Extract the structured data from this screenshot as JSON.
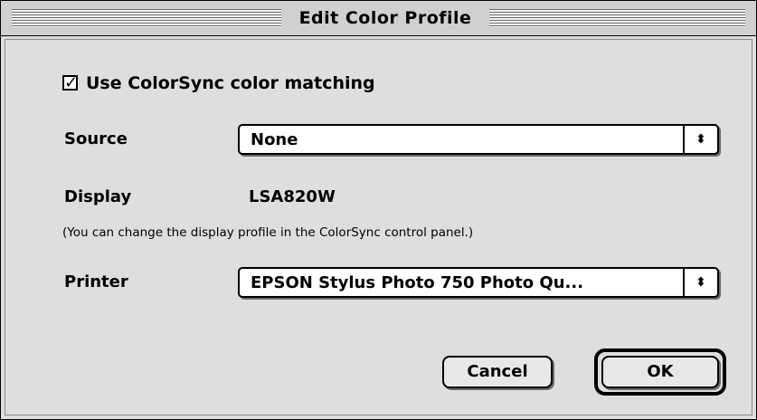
{
  "window": {
    "title": "Edit Color Profile"
  },
  "colorsync": {
    "checked": true,
    "check_glyph": "✓",
    "label": "Use ColorSync color matching"
  },
  "source": {
    "label": "Source",
    "selected": "None",
    "arrow_glyph": "⬍"
  },
  "display": {
    "label": "Display",
    "value": "LSA820W",
    "note": "(You can change the display profile in the ColorSync control panel.)"
  },
  "printer": {
    "label": "Printer",
    "selected": "EPSON Stylus Photo 750 Photo Qu...",
    "arrow_glyph": "⬍"
  },
  "buttons": {
    "cancel": "Cancel",
    "ok": "OK"
  }
}
